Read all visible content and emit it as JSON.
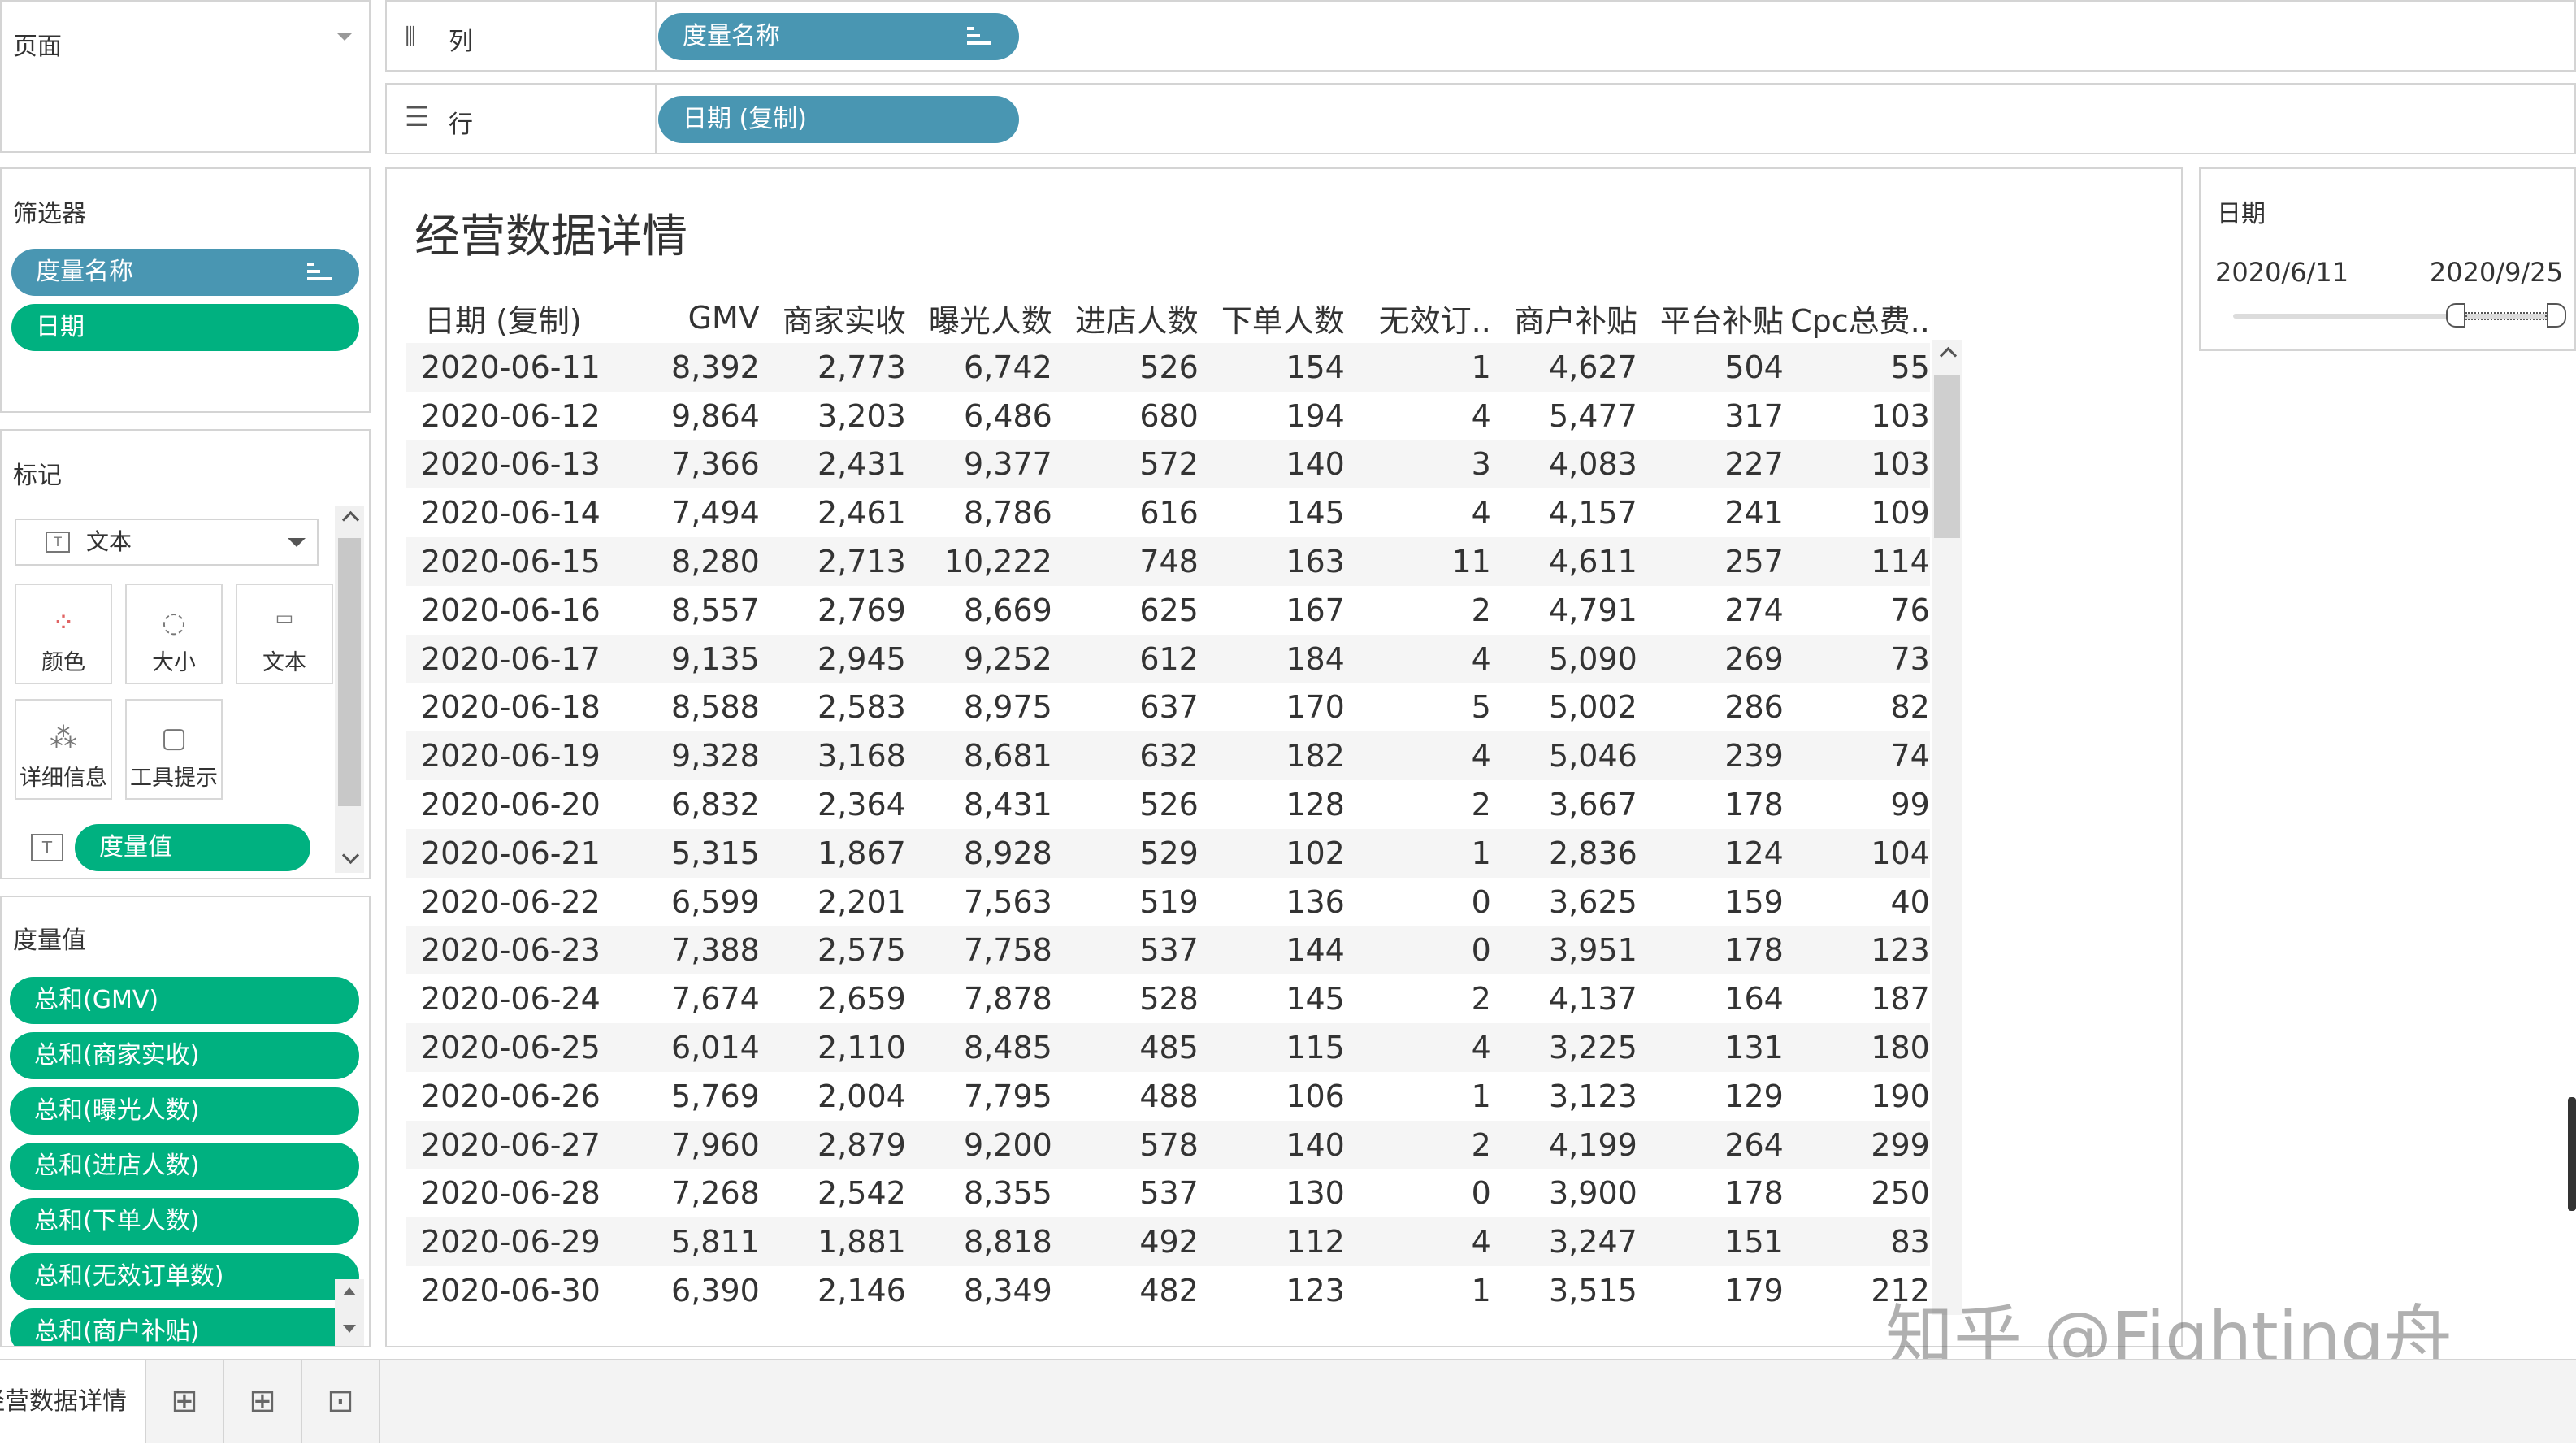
{
  "pages_card": {
    "title": "页面"
  },
  "filters_card": {
    "title": "筛选器",
    "items": [
      {
        "label": "度量名称",
        "color": "blue"
      },
      {
        "label": "日期",
        "color": "green"
      }
    ]
  },
  "marks_card": {
    "title": "标记",
    "mark_type": "文本",
    "buttons": [
      "颜色",
      "大小",
      "文本",
      "详细信息",
      "工具提示"
    ],
    "field_pill": "度量值"
  },
  "measure_values_card": {
    "title": "度量值",
    "items": [
      "总和(GMV)",
      "总和(商家实收)",
      "总和(曝光人数)",
      "总和(进店人数)",
      "总和(下单人数)",
      "总和(无效订单数)",
      "总和(商户补贴)"
    ]
  },
  "shelves": {
    "columns": {
      "label": "列",
      "pill": "度量名称"
    },
    "rows": {
      "label": "行",
      "pill": "日期 (复制)"
    }
  },
  "view": {
    "title": "经营数据详情",
    "headers": [
      "日期 (复制)",
      "GMV",
      "商家实收",
      "曝光人数",
      "进店人数",
      "下单人数",
      "无效订..",
      "商户补贴",
      "平台补贴",
      "Cpc总费.."
    ],
    "rows": [
      [
        "2020-06-11",
        "8,392",
        "2,773",
        "6,742",
        "526",
        "154",
        "1",
        "4,627",
        "504",
        "55"
      ],
      [
        "2020-06-12",
        "9,864",
        "3,203",
        "6,486",
        "680",
        "194",
        "4",
        "5,477",
        "317",
        "103"
      ],
      [
        "2020-06-13",
        "7,366",
        "2,431",
        "9,377",
        "572",
        "140",
        "3",
        "4,083",
        "227",
        "103"
      ],
      [
        "2020-06-14",
        "7,494",
        "2,461",
        "8,786",
        "616",
        "145",
        "4",
        "4,157",
        "241",
        "109"
      ],
      [
        "2020-06-15",
        "8,280",
        "2,713",
        "10,222",
        "748",
        "163",
        "11",
        "4,611",
        "257",
        "114"
      ],
      [
        "2020-06-16",
        "8,557",
        "2,769",
        "8,669",
        "625",
        "167",
        "2",
        "4,791",
        "274",
        "76"
      ],
      [
        "2020-06-17",
        "9,135",
        "2,945",
        "9,252",
        "612",
        "184",
        "4",
        "5,090",
        "269",
        "73"
      ],
      [
        "2020-06-18",
        "8,588",
        "2,583",
        "8,975",
        "637",
        "170",
        "5",
        "5,002",
        "286",
        "82"
      ],
      [
        "2020-06-19",
        "9,328",
        "3,168",
        "8,681",
        "632",
        "182",
        "4",
        "5,046",
        "239",
        "74"
      ],
      [
        "2020-06-20",
        "6,832",
        "2,364",
        "8,431",
        "526",
        "128",
        "2",
        "3,667",
        "178",
        "99"
      ],
      [
        "2020-06-21",
        "5,315",
        "1,867",
        "8,928",
        "529",
        "102",
        "1",
        "2,836",
        "124",
        "104"
      ],
      [
        "2020-06-22",
        "6,599",
        "2,201",
        "7,563",
        "519",
        "136",
        "0",
        "3,625",
        "159",
        "40"
      ],
      [
        "2020-06-23",
        "7,388",
        "2,575",
        "7,758",
        "537",
        "144",
        "0",
        "3,951",
        "178",
        "123"
      ],
      [
        "2020-06-24",
        "7,674",
        "2,659",
        "7,878",
        "528",
        "145",
        "2",
        "4,137",
        "164",
        "187"
      ],
      [
        "2020-06-25",
        "6,014",
        "2,110",
        "8,485",
        "485",
        "115",
        "4",
        "3,225",
        "131",
        "180"
      ],
      [
        "2020-06-26",
        "5,769",
        "2,004",
        "7,795",
        "488",
        "106",
        "1",
        "3,123",
        "129",
        "190"
      ],
      [
        "2020-06-27",
        "7,960",
        "2,879",
        "9,200",
        "578",
        "140",
        "2",
        "4,199",
        "264",
        "299"
      ],
      [
        "2020-06-28",
        "7,268",
        "2,542",
        "8,355",
        "537",
        "130",
        "0",
        "3,900",
        "178",
        "250"
      ],
      [
        "2020-06-29",
        "5,811",
        "1,881",
        "8,818",
        "492",
        "112",
        "4",
        "3,247",
        "151",
        "83"
      ],
      [
        "2020-06-30",
        "6,390",
        "2,146",
        "8,349",
        "482",
        "123",
        "1",
        "3,515",
        "179",
        "212"
      ]
    ]
  },
  "date_filter": {
    "title": "日期",
    "start": "2020/6/11",
    "end": "2020/9/25"
  },
  "tabs": {
    "active_sheet": "经营数据详情"
  },
  "watermark": "知乎 @Fighting舟",
  "colors": {
    "pill_blue": "#4996b2",
    "pill_green": "#00b180",
    "border": "#d4d4d4"
  }
}
